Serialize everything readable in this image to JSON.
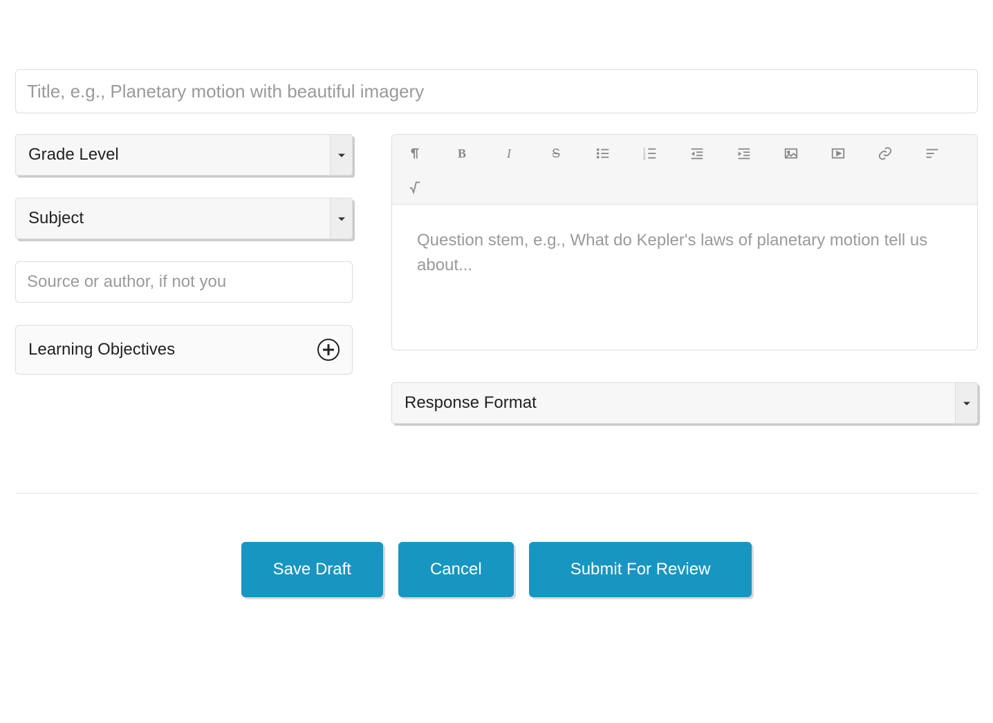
{
  "title": {
    "value": "",
    "placeholder": "Title, e.g., Planetary motion with beautiful imagery"
  },
  "left_panel": {
    "grade_level": {
      "label": "Grade Level",
      "value": ""
    },
    "subject": {
      "label": "Subject",
      "value": ""
    },
    "source": {
      "value": "",
      "placeholder": "Source or author, if not you"
    },
    "learning_objectives": {
      "label": "Learning Objectives"
    }
  },
  "editor": {
    "question_stem": {
      "value": "",
      "placeholder": "Question stem, e.g., What do Kepler's laws of planetary motion tell us about..."
    },
    "toolbar_icons": {
      "paragraph": "paragraph-icon",
      "bold": "bold-icon",
      "italic": "italic-icon",
      "strike": "strikethrough-icon",
      "ul": "bullet-list-icon",
      "ol": "numbered-list-icon",
      "outdent": "outdent-icon",
      "indent": "indent-icon",
      "image": "image-icon",
      "video": "video-icon",
      "link": "link-icon",
      "align": "align-icon",
      "math": "math-icon"
    }
  },
  "response_format": {
    "label": "Response Format",
    "value": ""
  },
  "actions": {
    "save_draft": "Save Draft",
    "cancel": "Cancel",
    "submit": "Submit For Review"
  }
}
